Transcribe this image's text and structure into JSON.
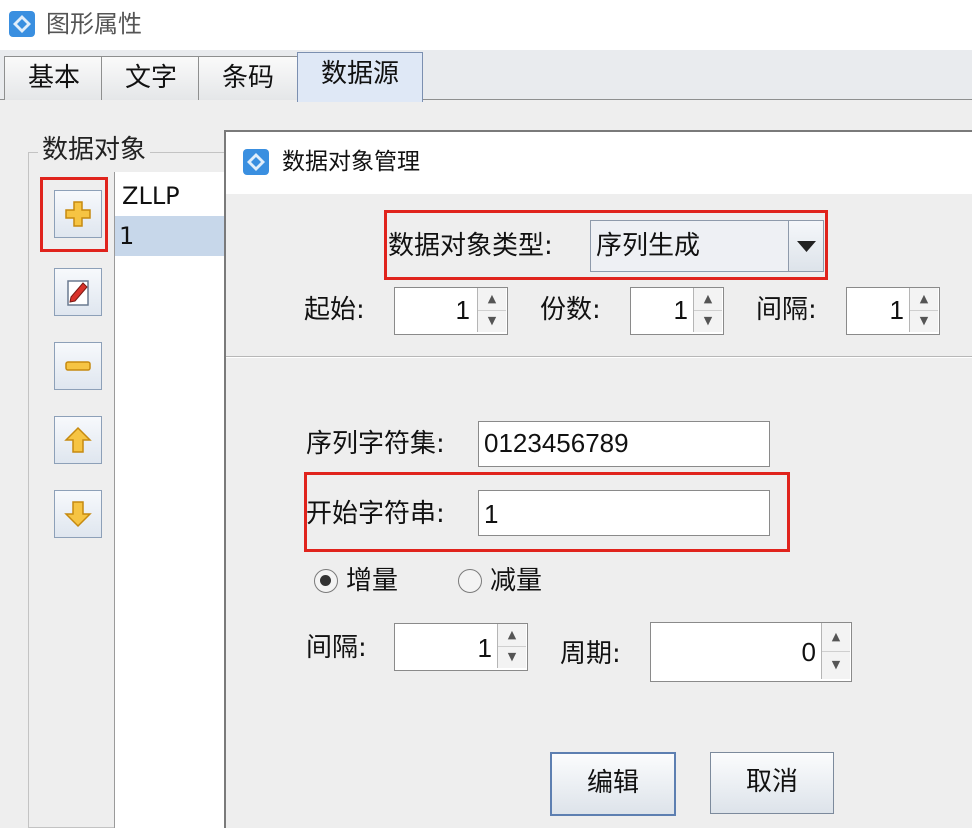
{
  "window": {
    "title": "图形属性"
  },
  "tabs": [
    {
      "label": "基本",
      "active": false
    },
    {
      "label": "文字",
      "active": false
    },
    {
      "label": "条码",
      "active": false
    },
    {
      "label": "数据源",
      "active": true
    }
  ],
  "data_objects": {
    "group_label": "数据对象",
    "items": [
      {
        "label": "ZLLP",
        "selected": false
      },
      {
        "label": "1",
        "selected": true
      }
    ],
    "toolbar_icons": [
      "add-icon",
      "edit-icon",
      "remove-icon",
      "move-up-icon",
      "move-down-icon"
    ]
  },
  "dialog": {
    "title": "数据对象管理",
    "type_label": "数据对象类型:",
    "type_value": "序列生成",
    "start_label": "起始:",
    "start_value": "1",
    "count_label": "份数:",
    "count_value": "1",
    "interval_label": "间隔:",
    "interval_value": "1",
    "charset_label": "序列字符集:",
    "charset_value": "0123456789",
    "start_string_label": "开始字符串:",
    "start_string_value": "1",
    "increment_label": "增量",
    "decrement_label": "减量",
    "increment_selected": true,
    "interval2_label": "间隔:",
    "interval2_value": "1",
    "period_label": "周期:",
    "period_value": "0",
    "edit_button": "编辑",
    "cancel_button": "取消"
  },
  "colors": {
    "highlight": "#e0231c",
    "selection": "#c7d7ea"
  }
}
